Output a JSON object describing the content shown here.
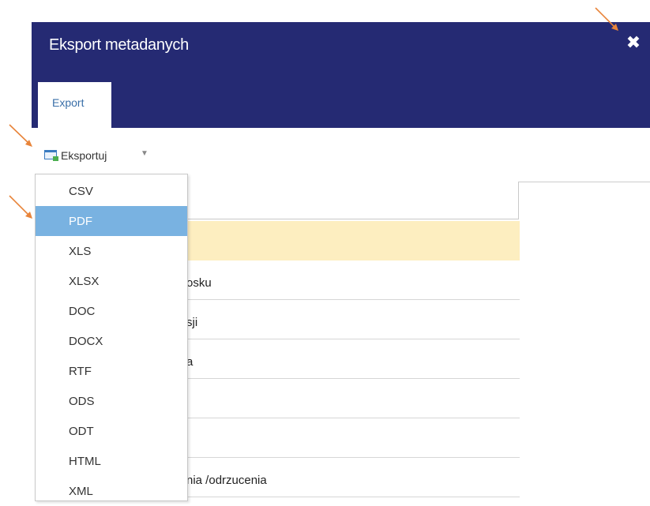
{
  "dialog": {
    "title": "Eksport metadanych",
    "close_glyph": "✖",
    "header_color": "#252a73"
  },
  "tabs": [
    {
      "label": "Export",
      "active": true
    }
  ],
  "toolbar": {
    "export_label": "Eksportuj",
    "export_icon": "export-icon",
    "caret_glyph": "▼"
  },
  "dropdown": {
    "items": [
      "CSV",
      "PDF",
      "XLS",
      "XLSX",
      "DOC",
      "DOCX",
      "RTF",
      "ODS",
      "ODT",
      "HTML",
      "XML"
    ],
    "selected": "PDF",
    "selected_color": "#79b2e1"
  },
  "grid": {
    "rows": [
      {
        "text": "",
        "highlighted": true
      },
      {
        "text": "osku"
      },
      {
        "text": "sji"
      },
      {
        "text": "a"
      },
      {
        "text": ""
      },
      {
        "text": ""
      },
      {
        "text": "nia /odrzucenia"
      }
    ],
    "highlight_color": "#fdeec0"
  },
  "annotations": {
    "arrow_color": "#e8843a"
  }
}
